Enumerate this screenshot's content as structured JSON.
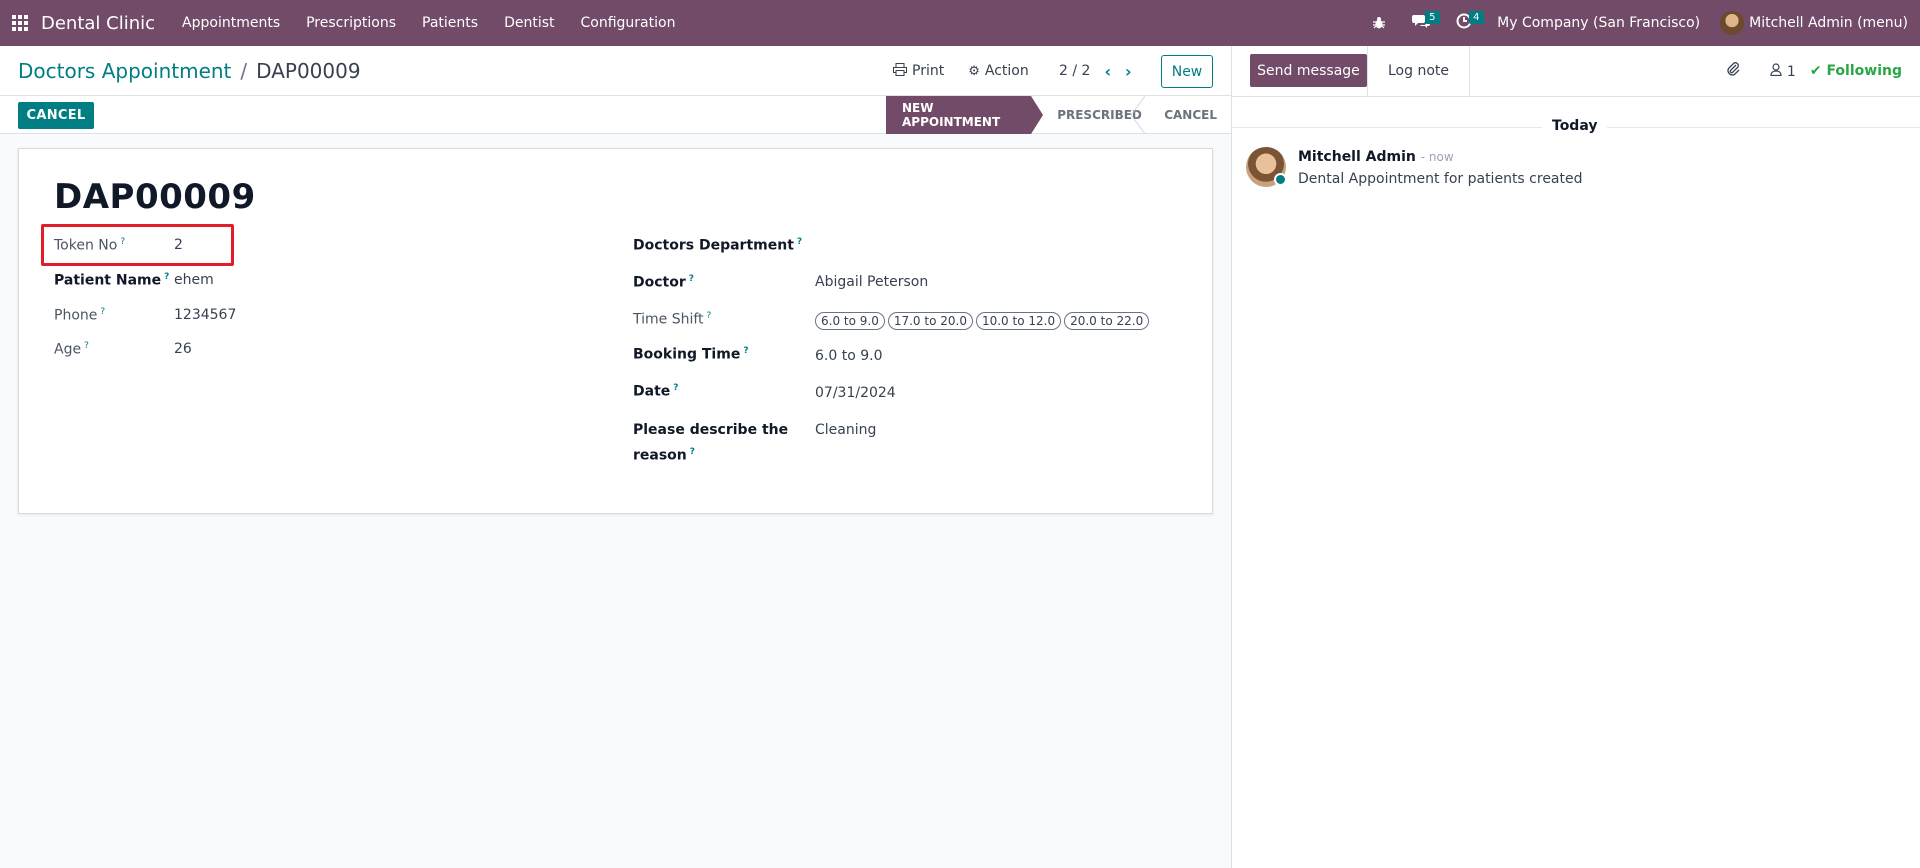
{
  "navbar": {
    "brand": "Dental Clinic",
    "menu": [
      "Appointments",
      "Prescriptions",
      "Patients",
      "Dentist",
      "Configuration"
    ],
    "messages_count": "5",
    "activities_count": "4",
    "company": "My Company (San Francisco)",
    "user": "Mitchell Admin (menu)"
  },
  "control": {
    "breadcrumb_parent": "Doctors Appointment",
    "breadcrumb_sep": "/",
    "breadcrumb_current": "DAP00009",
    "print_label": "Print",
    "action_label": "Action",
    "pager": "2 / 2",
    "new_label": "New"
  },
  "statusbar": {
    "cancel_label": "CANCEL",
    "stages": [
      "NEW APPOINTMENT",
      "PRESCRIBED",
      "CANCEL"
    ],
    "active_stage": "NEW APPOINTMENT"
  },
  "form": {
    "title": "DAP00009",
    "left_fields": [
      {
        "label": "Token No",
        "value": "2"
      },
      {
        "label": "Patient Name",
        "value": "ehem"
      },
      {
        "label": "Phone",
        "value": "1234567"
      },
      {
        "label": "Age",
        "value": "26"
      }
    ],
    "right_fields": {
      "department_label": "Doctors Department",
      "department_value": "",
      "doctor_label": "Doctor",
      "doctor_value": "Abigail Peterson",
      "time_shift_label": "Time Shift",
      "time_shift_tags": [
        "6.0 to 9.0",
        "17.0 to 20.0",
        "10.0 to 12.0",
        "20.0 to 22.0"
      ],
      "booking_time_label": "Booking Time",
      "booking_time_value": "6.0 to 9.0",
      "date_label": "Date",
      "date_value": "07/31/2024",
      "reason_label_1": "Please describe the",
      "reason_label_2": "reason",
      "reason_value": "Cleaning"
    },
    "help_mark": "?"
  },
  "chatter": {
    "send_message": "Send message",
    "log_note": "Log note",
    "followers_count": "1",
    "following": "Following",
    "today": "Today",
    "message": {
      "author": "Mitchell Admin",
      "time": "- now",
      "body": "Dental Appointment for patients created"
    }
  },
  "colors": {
    "brand": "#714b67",
    "accent": "#017e84",
    "highlight": "#e11d2a",
    "following": "#28a745"
  }
}
